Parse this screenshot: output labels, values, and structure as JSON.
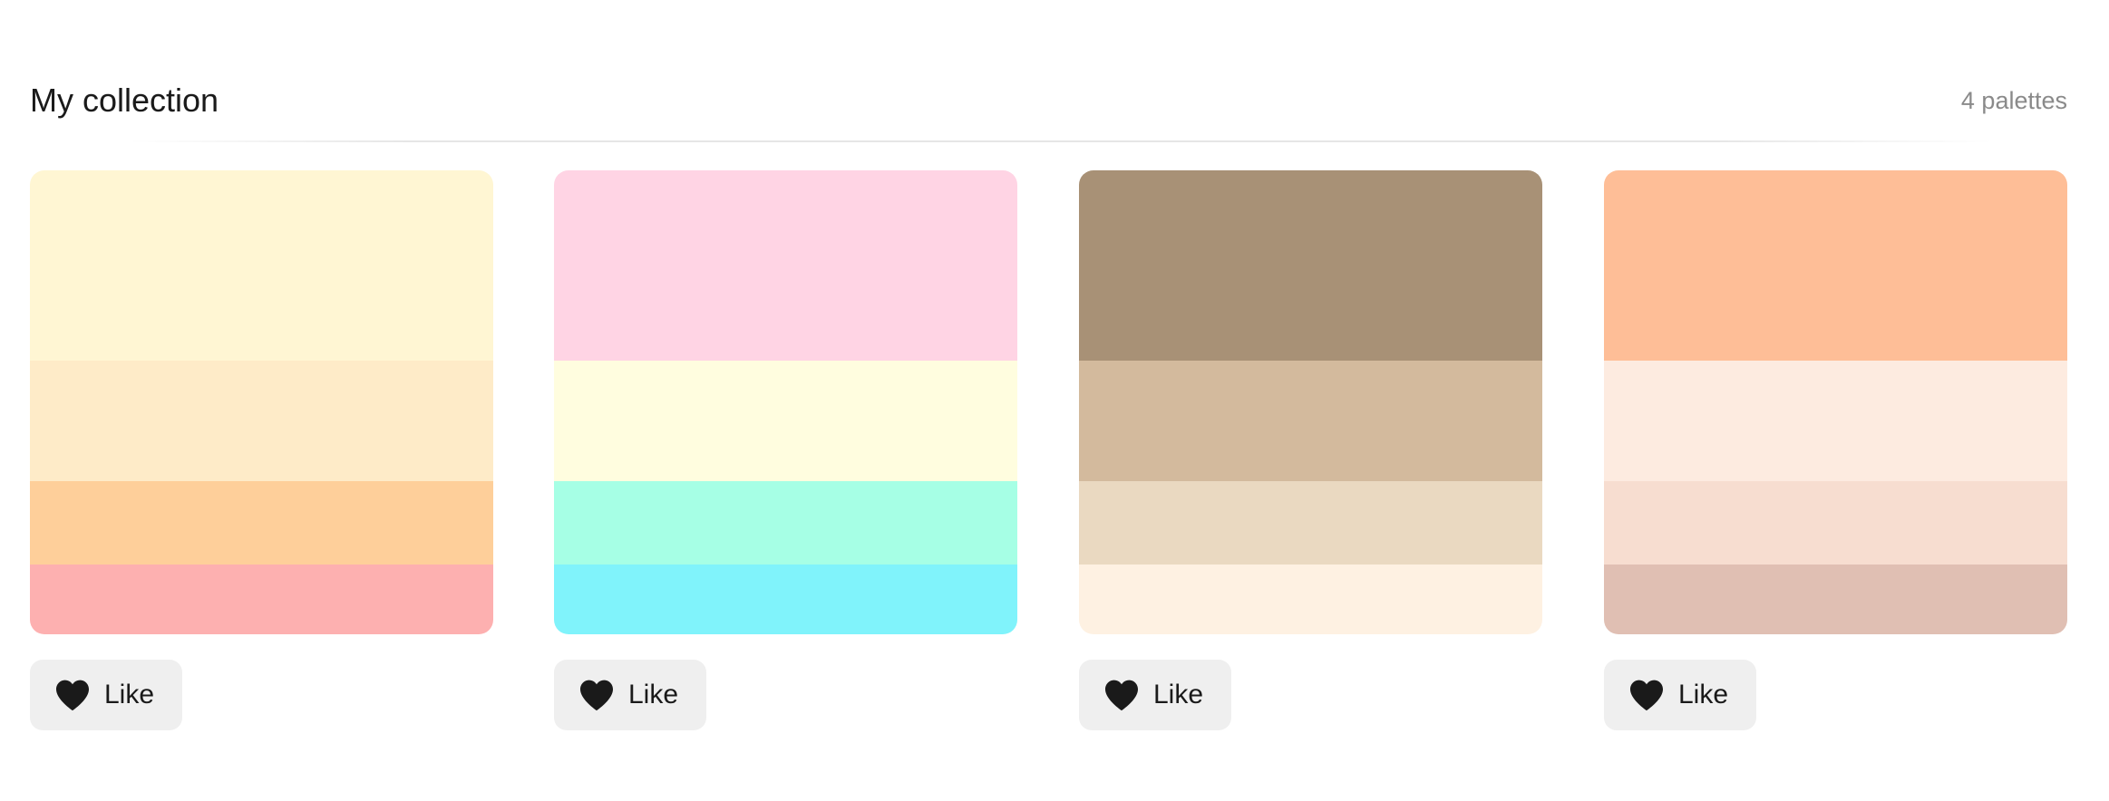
{
  "header": {
    "title": "My collection",
    "count": "4 palettes"
  },
  "palettes": [
    {
      "colors": [
        "#FFF6D3",
        "#FEEBC8",
        "#FECF9A",
        "#FDB0B0"
      ],
      "like_label": "Like"
    },
    {
      "colors": [
        "#FFD4E4",
        "#FFFDDF",
        "#A6FFE5",
        "#80F3FB"
      ],
      "like_label": "Like"
    },
    {
      "colors": [
        "#A89176",
        "#D3BA9D",
        "#EAD9C1",
        "#FEF1E2"
      ],
      "like_label": "Like"
    },
    {
      "colors": [
        "#FEBE97",
        "#FDEBE0",
        "#F7DDD0",
        "#E0BFB3"
      ],
      "like_label": "Like"
    }
  ],
  "icons": {
    "like": "heart-icon"
  }
}
